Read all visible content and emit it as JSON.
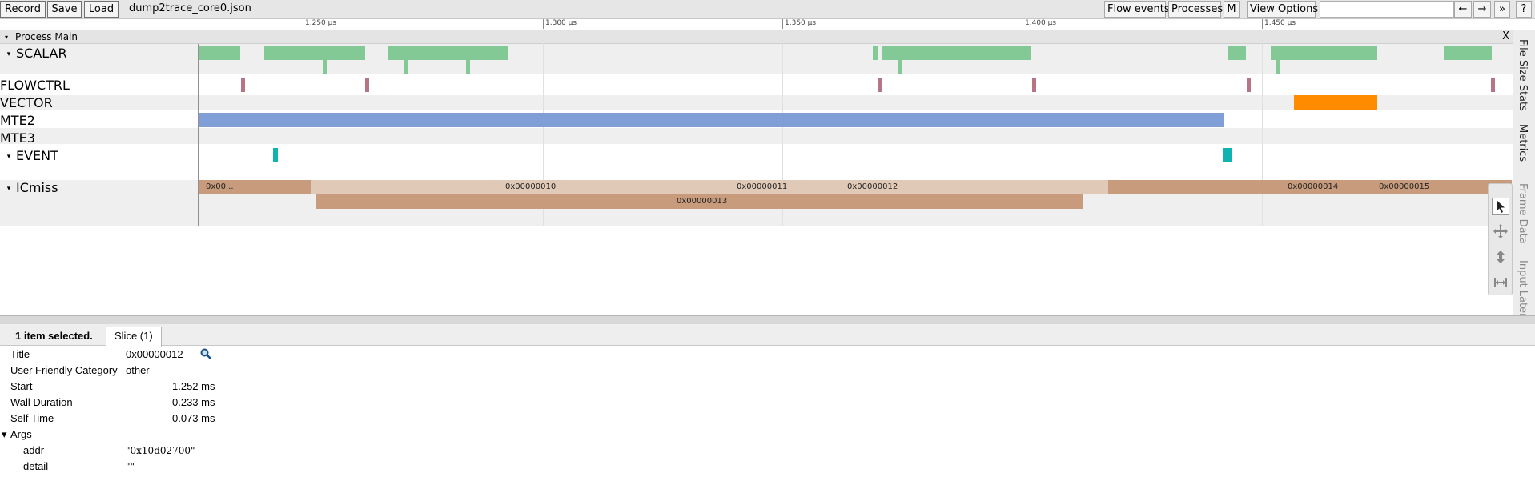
{
  "toolbar": {
    "record": "Record",
    "save": "Save",
    "load": "Load",
    "filename": "dump2trace_core0.json",
    "flow_events": "Flow events",
    "processes": "Processes",
    "m": "M",
    "view_options": "View Options",
    "search_value": "",
    "prev": "←",
    "next": "→",
    "more": "»",
    "help": "?"
  },
  "ruler": {
    "ticks": [
      "1.250 μs",
      "1.300 μs",
      "1.350 μs",
      "1.400 μs",
      "1.450 μs"
    ]
  },
  "process": {
    "title": "Process Main",
    "close": "X"
  },
  "tracks": {
    "scalar": "SCALAR",
    "flowctrl": "FLOWCTRL",
    "vector": "VECTOR",
    "mte2": "MTE2",
    "mte3": "MTE3",
    "event": "EVENT",
    "icmiss": "ICmiss"
  },
  "icmiss_slices": {
    "s0": "0x00...",
    "s10": "0x00000010",
    "s11": "0x00000011",
    "s12": "0x00000012",
    "s13": "0x00000013",
    "s14": "0x00000014",
    "s15": "0x00000015"
  },
  "side_tabs": {
    "file_size_stats": "File Size Stats",
    "metrics": "Metrics",
    "frame_data": "Frame Data",
    "input_latency": "Input Latency"
  },
  "panel": {
    "selected_count": "1 item selected.",
    "tab": "Slice (1)"
  },
  "selection": {
    "title_label": "Title",
    "title_value": "0x00000012",
    "category_label": "User Friendly Category",
    "category_value": "other",
    "start_label": "Start",
    "start_value": "1.252 ms",
    "wall_label": "Wall Duration",
    "wall_value": "0.233 ms",
    "self_label": "Self Time",
    "self_value": "0.073 ms",
    "args_label": "Args",
    "addr_label": "addr",
    "addr_value": "\"0x10d02700\"",
    "detail_label": "detail",
    "detail_value": "\"\""
  },
  "colors": {
    "scalar": "#82c995",
    "flowctrl": "#b57585",
    "vector": "#ff8c00",
    "mte2": "#7f9fd6",
    "event": "#10b3b0",
    "icmiss_dark": "#c79b7c",
    "icmiss_light": "#e1c9b7"
  },
  "icons": {
    "search": "magnifier-icon",
    "select_tool": "cursor-arrow-icon",
    "pan_tool": "move-cross-icon",
    "zoom_tool": "zoom-arrow-icon",
    "timing_tool": "timing-range-icon"
  }
}
